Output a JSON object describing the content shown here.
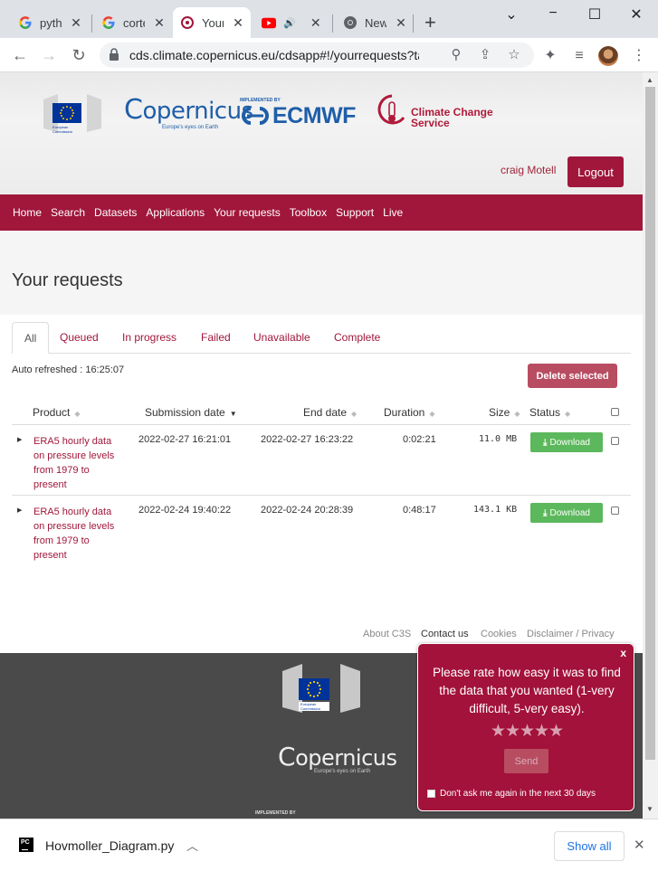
{
  "browser": {
    "tabs": [
      {
        "label": "pytho",
        "icon": "google-icon"
      },
      {
        "label": "corte",
        "icon": "google-icon"
      },
      {
        "label": "Your",
        "icon": "copernicus-favicon"
      },
      {
        "label": "",
        "icon": "youtube-icon"
      },
      {
        "label": "New",
        "icon": "chrome-icon"
      }
    ],
    "tab_close": "✕",
    "new_tab": "+",
    "url": "cds.climate.copernicus.eu/cdsapp#!/yourrequests?tab..."
  },
  "site": {
    "eu_label": "European Commission",
    "copernicus_word": "opernicus",
    "copernicus_tagline": "Europe's eyes on Earth",
    "ecmwf_implemented": "IMPLEMENTED BY",
    "ecmwf_word": "ECMWF",
    "c3s_line1": "Climate Change",
    "c3s_line2": "Service",
    "username": "craig Motell",
    "logout": "Logout"
  },
  "nav": [
    "Home",
    "Search",
    "Datasets",
    "Applications",
    "Your requests",
    "Toolbox",
    "Support",
    "Live"
  ],
  "page_title": "Your requests",
  "filter_tabs": [
    "All",
    "Queued",
    "In progress",
    "Failed",
    "Unavailable",
    "Complete"
  ],
  "auto_refreshed": "Auto refreshed : 16:25:07",
  "delete_selected": "Delete selected",
  "columns": {
    "product": "Product",
    "submission": "Submission date",
    "end": "End date",
    "duration": "Duration",
    "size": "Size",
    "status": "Status"
  },
  "requests": [
    {
      "product": "ERA5 hourly data on pressure levels from 1979 to present",
      "submission": "2022-02-27 16:21:01",
      "end": "2022-02-27 16:23:22",
      "duration": "0:02:21",
      "size": "11.0 MB",
      "action": "Download"
    },
    {
      "product": "ERA5 hourly data on pressure levels from 1979 to present",
      "submission": "2022-02-24 19:40:22",
      "end": "2022-02-24 20:28:39",
      "duration": "0:48:17",
      "size": "143.1 KB",
      "action": "Download"
    }
  ],
  "footer_links": [
    "About C3S",
    "Contact us",
    "Cookies",
    "Disclaimer / Privacy"
  ],
  "footer": {
    "implemented_by": "IMPLEMENTED BY"
  },
  "popup": {
    "close": "x",
    "question": "Please rate how easy it was to find the data that you wanted (1-very difficult, 5-very easy).",
    "stars": "★★★★★",
    "rating_max": 5,
    "send": "Send",
    "dont_ask": "Don't ask me again in the next 30 days"
  },
  "download_bar": {
    "file_name": "Hovmoller_Diagram.py",
    "show_all": "Show all"
  },
  "colors": {
    "brand": "#a0173b",
    "download_green": "#5cb85c",
    "link_blue": "#1a73e8"
  }
}
